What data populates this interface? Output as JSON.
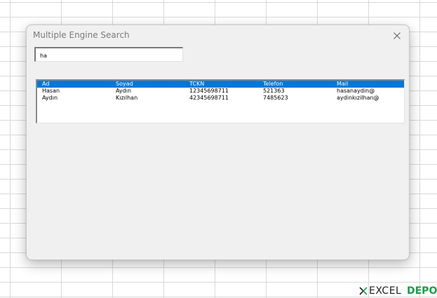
{
  "dialog": {
    "title": "Multiple Engine Search",
    "close_icon": "close-icon"
  },
  "search": {
    "value": "ha"
  },
  "listbox": {
    "selection_color": "#0078d7",
    "columns": [
      "Ad",
      "Soyad",
      "TCKN",
      "Telefon",
      "Mail"
    ],
    "rows": [
      [
        "Hasan",
        "Aydın",
        "12345698711",
        "521363",
        "hasanaydin@"
      ],
      [
        "Aydın",
        "Kızılhan",
        "42345698711",
        "7485623",
        "aydinkızilhan@"
      ]
    ]
  },
  "watermark": {
    "excel": "EXCEL",
    "depo": "DEPO",
    "brand_color": "#1b9e4a"
  }
}
